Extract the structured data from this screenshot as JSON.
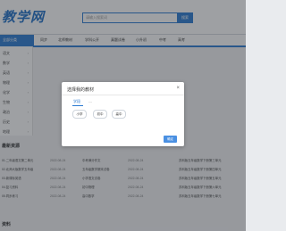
{
  "header": {
    "logo": "教学网",
    "search_placeholder": "请输入搜索词",
    "search_button": "搜索"
  },
  "nav": {
    "category": "全部分类",
    "items": [
      "同步",
      "北师教材",
      "学科公开",
      "真题试卷",
      "小升初",
      "中考",
      "高考"
    ]
  },
  "sidebar": {
    "items": [
      "语文",
      "数学",
      "英语",
      "物理",
      "化学",
      "生物",
      "政治",
      "历史",
      "地理"
    ]
  },
  "sections": {
    "latest_title": "最新资源",
    "bottom_title": "资料"
  },
  "lists": {
    "left": [
      {
        "title": "01.二年级语文第二单元",
        "date": "2022-08-24"
      },
      {
        "title": "02.北师大版数学五年级",
        "date": "2022-08-24"
      },
      {
        "title": "03.新课标英语",
        "date": "2022-08-24"
      },
      {
        "title": "04.复习资料",
        "date": "2022-08-24"
      },
      {
        "title": "05.同步练习",
        "date": "2022-08-24"
      }
    ],
    "middle": [
      {
        "title": "中考满分作文",
        "date": "2022-08-24"
      },
      {
        "title": "五年级数学期末试卷",
        "date": "2022-08-24"
      },
      {
        "title": "小学语文试卷",
        "date": "2022-08-24"
      },
      {
        "title": "初中物理",
        "date": "2022-08-24"
      },
      {
        "title": "高中数学",
        "date": "2022-08-24"
      }
    ],
    "right": [
      "苏科版五年级数学下册第三单元",
      "苏科版五年级数学下册第四单元",
      "苏科版五年级数学下册第五单元",
      "苏科版五年级数学下册第六单元",
      "苏科版五年级数学下册第七单元"
    ]
  },
  "dialog": {
    "title": "选择我的教材",
    "close": "×",
    "tabs": [
      "学段",
      "---"
    ],
    "options": [
      "小学",
      "初中",
      "高中"
    ],
    "confirm": "确定"
  },
  "colors": {
    "accent": "#2b7ad1",
    "overlay": "rgba(40,44,52,0.45)"
  }
}
